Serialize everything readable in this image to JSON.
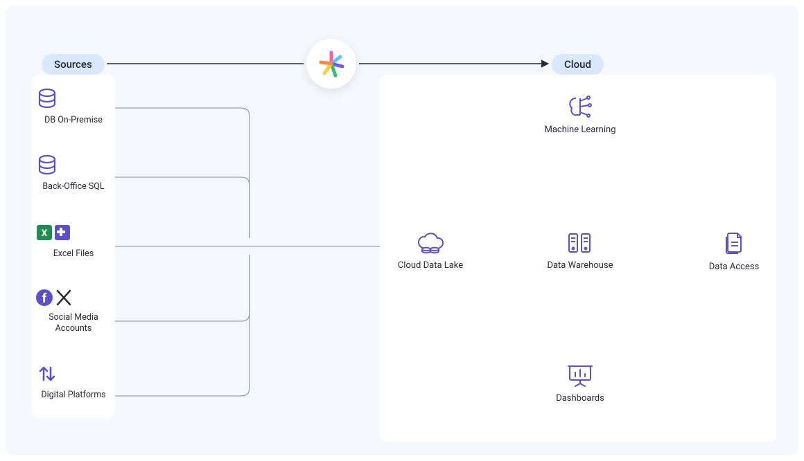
{
  "labels": {
    "sources_pill": "Sources",
    "cloud_pill": "Cloud"
  },
  "sources": [
    {
      "id": "db-onprem",
      "label": "DB On-Premise"
    },
    {
      "id": "back-office",
      "label": "Back-Office SQL"
    },
    {
      "id": "excel",
      "label": "Excel Files"
    },
    {
      "id": "social",
      "label": "Social Media Accounts"
    },
    {
      "id": "digital",
      "label": "Digital Platforms"
    }
  ],
  "cloud_nodes": {
    "ml": "Machine Learning",
    "lake": "Cloud Data Lake",
    "warehouse": "Data Warehouse",
    "access": "Data Access",
    "dashboards": "Dashboards"
  },
  "colors": {
    "icon_purple": "#5a4fcf",
    "wire_gray": "#9aa0a8",
    "arrow_dark": "#2a2a35",
    "pill_bg": "#d9e8ff"
  }
}
